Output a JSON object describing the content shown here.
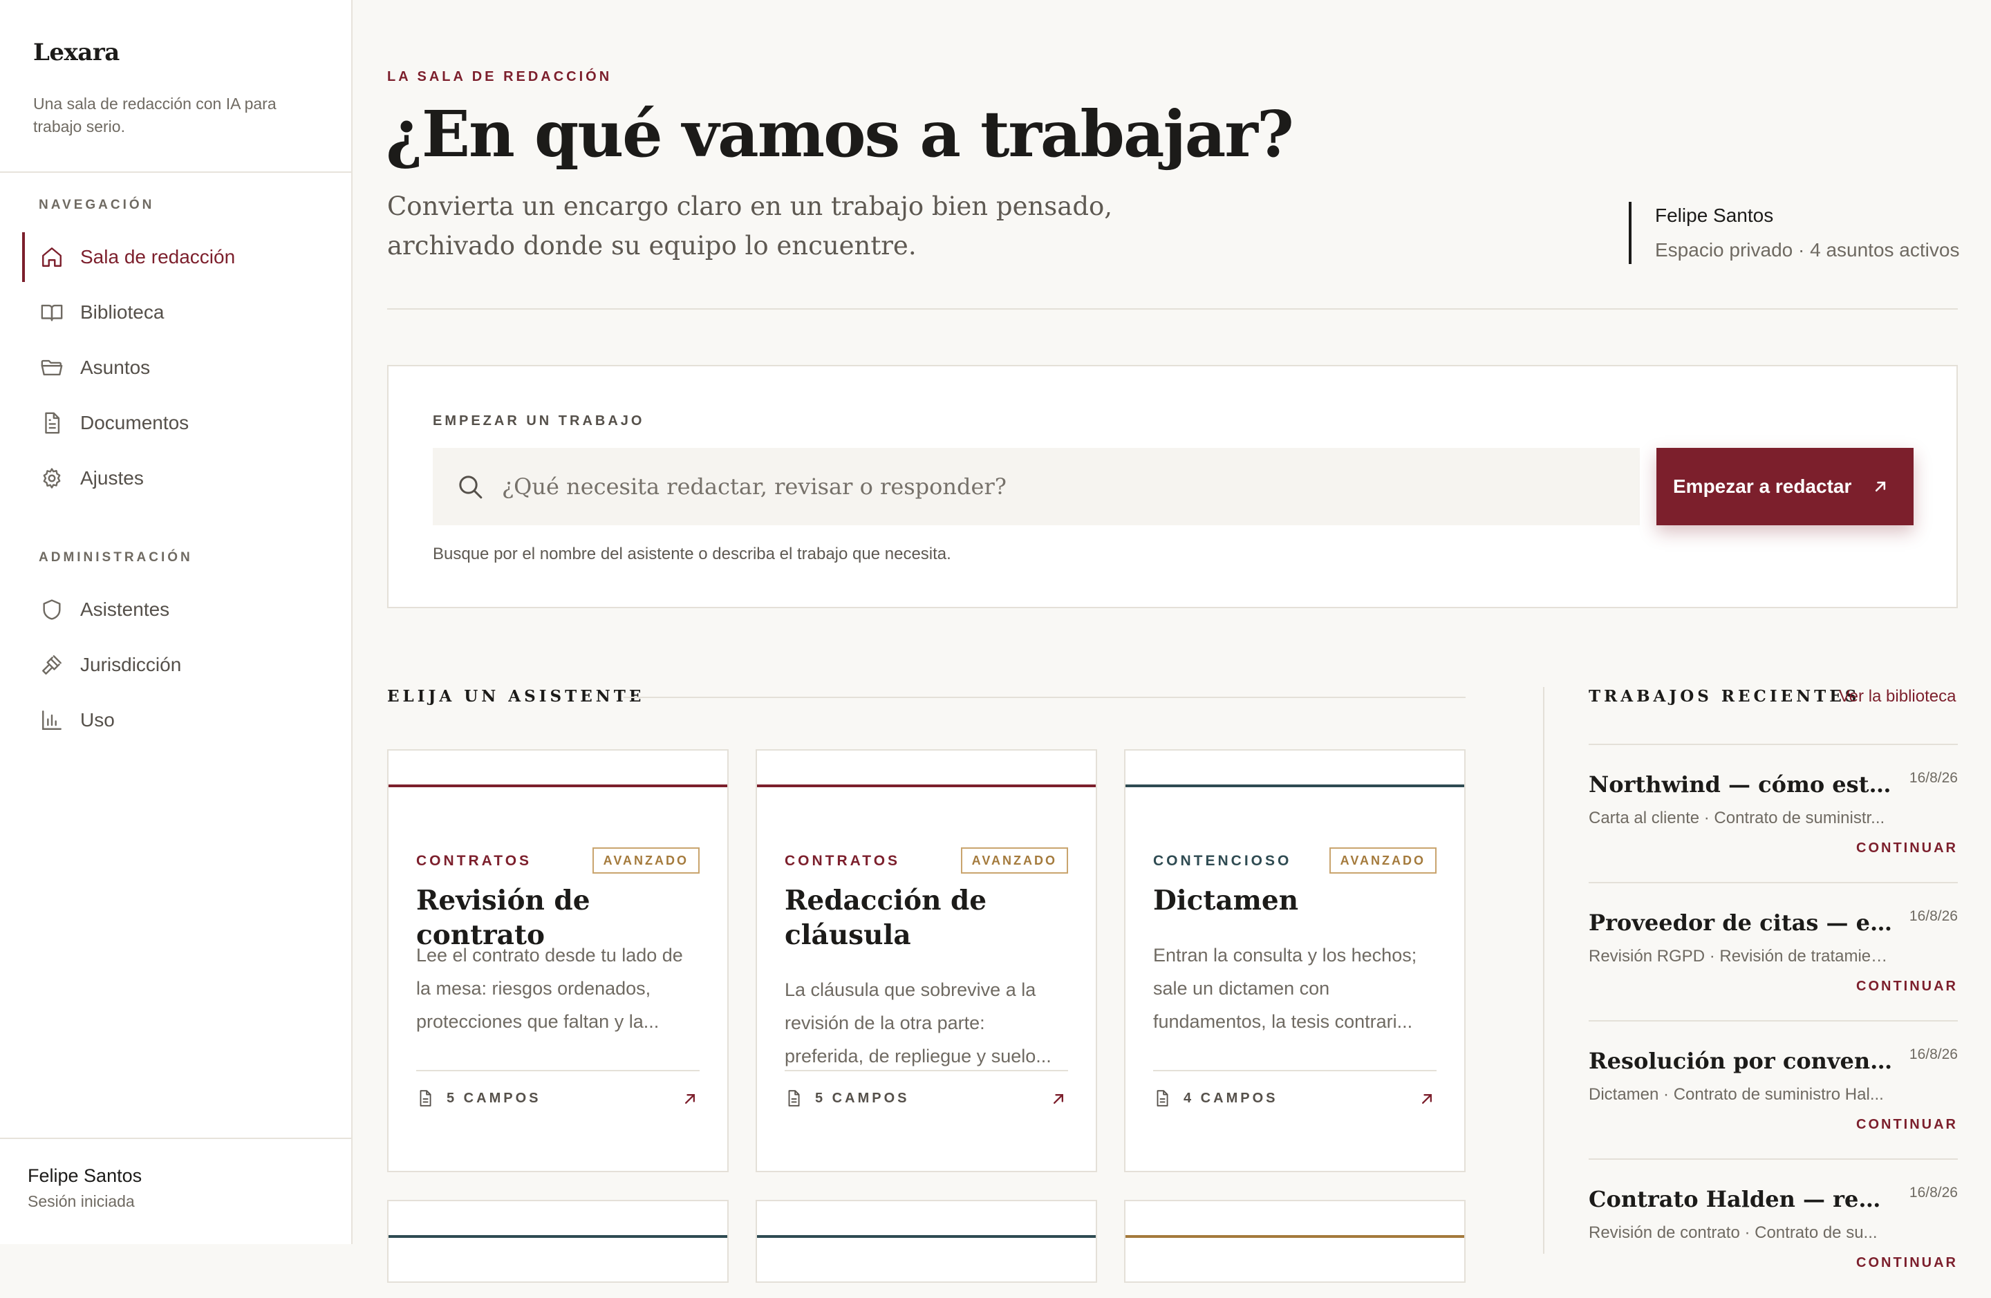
{
  "app": {
    "name": "Lexara",
    "tagline": "Una sala de redacción con IA para trabajo serio."
  },
  "sidebar": {
    "sections": [
      {
        "label": "NAVEGACIÓN"
      },
      {
        "label": "ADMINISTRACIÓN"
      }
    ],
    "nav": [
      {
        "label": "Sala de redacción",
        "icon": "home-icon",
        "active": true
      },
      {
        "label": "Biblioteca",
        "icon": "book-icon"
      },
      {
        "label": "Asuntos",
        "icon": "folder-icon"
      },
      {
        "label": "Documentos",
        "icon": "document-icon"
      },
      {
        "label": "Ajustes",
        "icon": "gear-icon"
      }
    ],
    "admin": [
      {
        "label": "Asistentes",
        "icon": "shield-icon"
      },
      {
        "label": "Jurisdicción",
        "icon": "gavel-icon"
      },
      {
        "label": "Uso",
        "icon": "bar-chart-icon"
      }
    ],
    "user": {
      "name": "Felipe Santos",
      "status": "Sesión iniciada"
    }
  },
  "header": {
    "eyebrow": "LA SALA DE REDACCIÓN",
    "title": "¿En qué vamos a trabajar?",
    "subtitle": "Convierta un encargo claro en un trabajo bien pensado, archivado donde su equipo lo encuentre.",
    "account_name": "Felipe Santos",
    "account_meta": "Espacio privado · 4 asuntos activos"
  },
  "start": {
    "label": "EMPEZAR UN TRABAJO",
    "placeholder": "¿Qué necesita redactar, revisar o responder?",
    "button": "Empezar a redactar",
    "hint": "Busque por el nombre del asistente o describa el trabajo que necesita."
  },
  "assistants": {
    "heading": "ELIJA UN ASISTENTE",
    "cards": [
      {
        "category": "CONTRATOS",
        "level": "AVANZADO",
        "title": "Revisión de contrato",
        "description": "Lee el contrato desde tu lado de la mesa: riesgos ordenados, protecciones que faltan y la...",
        "fields": "5 CAMPOS",
        "accent": "#7c1f2c"
      },
      {
        "category": "CONTRATOS",
        "level": "AVANZADO",
        "title": "Redacción de cláusula",
        "description": "La cláusula que sobrevive a la revisión de la otra parte: preferida, de repliegue y suelo...",
        "fields": "5 CAMPOS",
        "accent": "#7c1f2c"
      },
      {
        "category": "CONTENCIOSO",
        "level": "AVANZADO",
        "title": "Dictamen",
        "description": "Entran la consulta y los hechos; sale un dictamen con fundamentos, la tesis contrari...",
        "fields": "4 CAMPOS",
        "accent": "#2f4b52"
      }
    ],
    "next_row_accents": [
      "#2f4b52",
      "#2f4b52",
      "#a47a3c"
    ]
  },
  "recent": {
    "heading": "TRABAJOS RECIENTES",
    "link": "Ver la biblioteca",
    "items": [
      {
        "title": "Northwind — cómo está el ...",
        "date": "16/8/26",
        "meta": "Carta al cliente · Contrato de suministr...",
        "cta": "CONTINUAR"
      },
      {
        "title": "Proveedor de citas — evalu...",
        "date": "16/8/26",
        "meta": "Revisión RGPD · Revisión de tratamien...",
        "cta": "CONTINUAR"
      },
      {
        "title": "Resolución por convenien...",
        "date": "16/8/26",
        "meta": "Dictamen · Contrato de suministro Hal...",
        "cta": "CONTINUAR"
      },
      {
        "title": "Contrato Halden — revisió...",
        "date": "16/8/26",
        "meta": "Revisión de contrato · Contrato de su...",
        "cta": "CONTINUAR"
      }
    ]
  },
  "colors": {
    "accent": "#7c1f2c",
    "teal": "#2f4b52",
    "gold": "#a47a3c",
    "background": "#f9f8f5"
  }
}
